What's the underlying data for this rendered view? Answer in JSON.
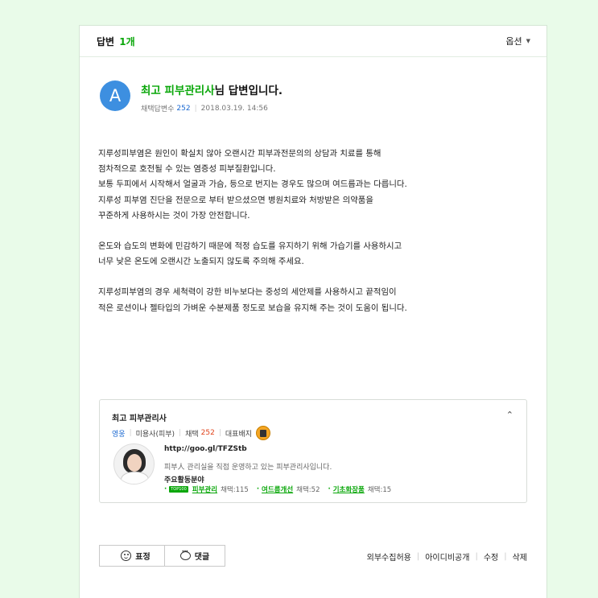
{
  "header": {
    "title": "답변",
    "count": "1개",
    "options_label": "옵션"
  },
  "answerer": {
    "avatar_letter": "A",
    "name": "최고 피부관리사",
    "suffix": "님 답변입니다.",
    "adopt_label": "채택답변수",
    "adopt_count": "252",
    "date": "2018.03.19. 14:56"
  },
  "body": {
    "paragraphs": [
      [
        "지루성피부염은 원인이 확실치 않아 오랜시간 피부과전문의의 상담과 치료를 통해",
        "점차적으로 호전될 수 있는 염증성 피부질환입니다.",
        "보통 두피에서 시작해서 얼굴과 가슴, 등으로 번지는 경우도 많으며 여드름과는 다릅니다.",
        "지루성 피부염 진단을 전문으로 부터 받으셨으면 병원치료와 처방받은 의약품을",
        "꾸준하게 사용하시는 것이 가장 안전합니다."
      ],
      [
        "온도와 습도의 변화에 민감하기 때문에 적정 습도를 유지하기 위해 가습기를 사용하시고",
        "너무 낮은 온도에 오랜시간 노출되지 않도록 주의해 주세요."
      ],
      [
        "지루성피부염의 경우 세척력이 강한 비누보다는 중성의 세안제를 사용하시고 끝적임이",
        "적은 로션이나 젤타입의 가벼운 수분제품 정도로 보습을 유지해 주는 것이 도움이 됩니다."
      ]
    ]
  },
  "expert": {
    "name": "최고 피부관리사",
    "grade": "영웅",
    "job": "미용사(피부)",
    "adopt_label": "채택",
    "adopt_count": "252",
    "badge_label": "대표배지",
    "url": "http://goo.gl/TFZStb",
    "description": "피부人 관리실을 직접 운영하고 있는 피부관리사입니다.",
    "field_title": "주요활동분야",
    "top100_label": "TOP100",
    "fields": [
      {
        "name": "피부관리",
        "count": "채택:115"
      },
      {
        "name": "여드름개선",
        "count": "채택:52"
      },
      {
        "name": "기초화장품",
        "count": "채택:15"
      }
    ]
  },
  "actions": {
    "emotion_label": "표정",
    "comment_label": "댓글",
    "links": [
      "외부수집허용",
      "아이디비공개",
      "수정",
      "삭제"
    ]
  },
  "colors": {
    "accent_green": "#0aa70a",
    "link_blue": "#1b69d1",
    "adopt_red": "#e0431b",
    "avatar_blue": "#3d8fe0",
    "page_bg": "#e9fbe9"
  }
}
